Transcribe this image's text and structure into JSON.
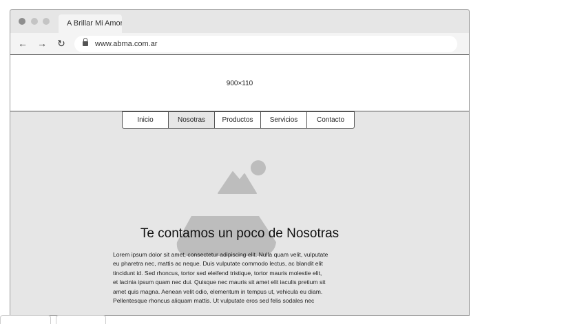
{
  "browser": {
    "tab_title": "A Brillar Mi Amor",
    "url": "www.abma.com.ar",
    "icons": {
      "back": "arrow-left-icon",
      "forward": "arrow-right-icon",
      "reload": "reload-icon",
      "lock": "lock-icon"
    }
  },
  "banner": {
    "label": "900×110"
  },
  "menu": {
    "items": [
      {
        "label": "Inicio",
        "active": false
      },
      {
        "label": "Nosotras",
        "active": true
      },
      {
        "label": "Productos",
        "active": false
      },
      {
        "label": "Servicios",
        "active": false
      },
      {
        "label": "Contacto",
        "active": false
      }
    ]
  },
  "main": {
    "image_icon": "image-placeholder-icon",
    "heading": "Te contamos un poco de Nosotras",
    "body_lines": [
      "Lorem ipsum dolor sit amet, consectetur adipiscing elit. Nulla quam velit, vulputate",
      "eu pharetra nec, mattis ac neque. Duis vulputate commodo lectus, ac blandit elit",
      "tincidunt id. Sed rhoncus, tortor sed eleifend tristique, tortor mauris molestie elit,",
      "et lacinia ipsum quam nec dui. Quisque nec mauris sit amet elit iaculis pretium sit",
      "amet quis magna. Aenean velit odio, elementum in tempus ut, vehicula eu diam.",
      "Pellentesque rhoncus aliquam mattis. Ut vulputate eros sed felis sodales nec"
    ]
  },
  "colors": {
    "page_background": "#e6e6e6",
    "placeholder_gray": "#bdbdbd",
    "border": "#555555"
  }
}
